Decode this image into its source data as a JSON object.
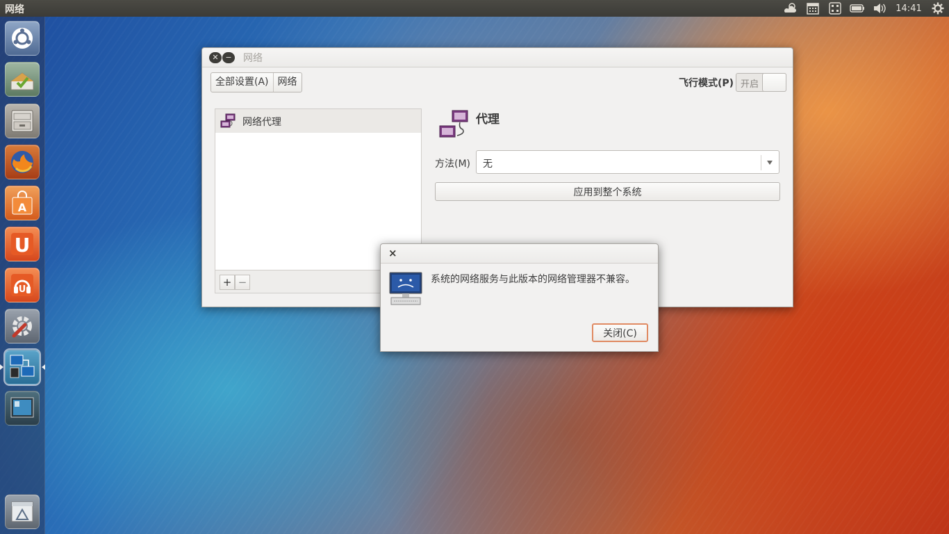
{
  "top_panel": {
    "app_title": "网络",
    "clock": "14:41",
    "indicators": [
      "weather-icon",
      "calendar-icon",
      "network-icon",
      "battery-icon",
      "volume-icon",
      "system-gear-icon"
    ]
  },
  "launcher": {
    "items": [
      {
        "name": "dash-home",
        "icon": "ubuntu-logo-icon"
      },
      {
        "name": "software-updater",
        "icon": "updater-icon"
      },
      {
        "name": "files",
        "icon": "file-cabinet-icon"
      },
      {
        "name": "firefox",
        "icon": "firefox-icon"
      },
      {
        "name": "software-center",
        "icon": "shopping-bag-icon"
      },
      {
        "name": "ubuntu-one",
        "icon": "ubuntu-one-icon"
      },
      {
        "name": "ubuntu-one-music",
        "icon": "music-icon"
      },
      {
        "name": "system-settings",
        "icon": "settings-wrench-icon"
      },
      {
        "name": "network",
        "icon": "network-computers-icon",
        "active": true
      },
      {
        "name": "workspace-switcher",
        "icon": "workspace-icon"
      },
      {
        "name": "trash",
        "icon": "trash-icon"
      }
    ]
  },
  "network_window": {
    "title": "网络",
    "all_settings": "全部设置(A)",
    "breadcrumb_network": "网络",
    "airplane_label": "飞行模式(P)",
    "airplane_state": "开启",
    "list_items": [
      "网络代理"
    ],
    "add_label": "+",
    "remove_label": "−",
    "proxy_heading": "代理",
    "method_label": "方法(M)",
    "method_value": "无",
    "apply_button": "应用到整个系统"
  },
  "dialog": {
    "close_glyph": "×",
    "message": "系统的网络服务与此版本的网络管理器不兼容。",
    "close_button": "关闭(C)"
  },
  "colors": {
    "top_panel": "#3c3b37",
    "window_bg": "#f2f1f0",
    "focus_accent": "#e08a62",
    "proxy_purple": "#7b3b80"
  }
}
